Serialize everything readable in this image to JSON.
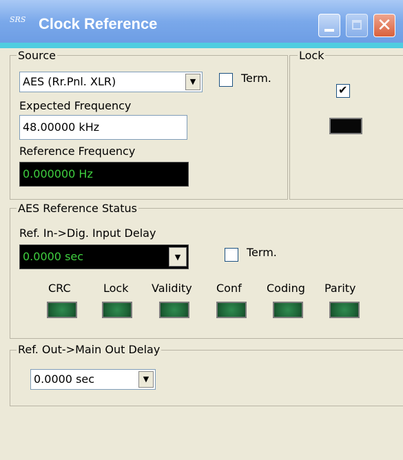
{
  "window": {
    "title": "Clock Reference",
    "logo_text": "SRS",
    "minimize_icon": "minimize-icon",
    "maximize_icon": "maximize-icon",
    "close_glyph": "✕"
  },
  "source": {
    "legend": "Source",
    "selected": "AES (Rr.Pnl. XLR)",
    "term_label": "Term.",
    "term_checked": false,
    "expected_label": "Expected Frequency",
    "expected_value": "48.00000 kHz",
    "reference_label": "Reference Frequency",
    "reference_value": "0.000000 Hz"
  },
  "lock": {
    "legend": "Lock",
    "checked": true
  },
  "aes_status": {
    "legend": "AES Reference Status",
    "delay_label": "Ref. In->Dig. Input Delay",
    "delay_value": "0.0000 sec",
    "term_label": "Term.",
    "term_checked": false,
    "indicators": [
      "CRC",
      "Lock",
      "Validity",
      "Conf",
      "Coding",
      "Parity"
    ]
  },
  "ref_out": {
    "legend": "Ref. Out->Main Out Delay",
    "delay_value": "0.0000 sec"
  },
  "colors": {
    "accent": "#4fcde0",
    "titlebar": "#7aa8ea",
    "dialog_bg": "#ece9d8",
    "readout_text": "#3fcf3f",
    "led_green": "#1d6336"
  }
}
